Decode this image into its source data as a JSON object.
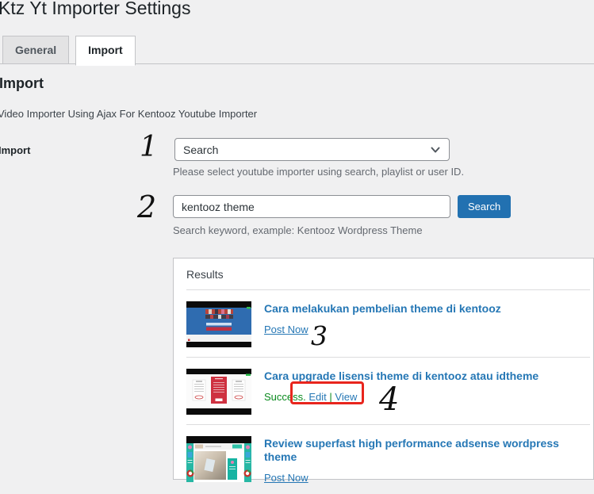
{
  "page": {
    "title": "Ktz Yt Importer Settings"
  },
  "tabs": [
    {
      "label": "General",
      "active": false
    },
    {
      "label": "Import",
      "active": true
    }
  ],
  "section": {
    "heading": "Import",
    "description": "Video Importer Using Ajax For Kentooz Youtube Importer"
  },
  "form": {
    "import_label": "Import",
    "importer_select": {
      "selected_value": "Search",
      "help": "Please select youtube importer using search, playlist or user ID."
    },
    "keyword_input": {
      "value": "kentooz theme",
      "help": "Search keyword, example: Kentooz Wordpress Theme"
    },
    "search_button_label": "Search"
  },
  "results": {
    "heading": "Results",
    "items": [
      {
        "title": "Cara melakukan pembelian theme di kentooz",
        "action": "Post Now",
        "thumb": "blue-storefront-video-thumbnail"
      },
      {
        "title": "Cara upgrade lisensi theme di kentooz atau idtheme",
        "status": "Success.",
        "edit_link": "Edit",
        "separator": "|",
        "view_link": "View",
        "thumb": "pricing-table-video-thumbnail"
      },
      {
        "title": "Review superfast high performance adsense wordpress theme",
        "action": "Post Now",
        "thumb": "teal-website-video-thumbnail"
      }
    ]
  },
  "annotations": {
    "steps": [
      "1",
      "2",
      "3",
      "4"
    ],
    "highlight_box_color": "#e8251d"
  },
  "colors": {
    "accent_blue": "#2271b1",
    "link_blue": "#2577b5",
    "success_green": "#0a8a1e",
    "panel_border": "#c3c4c7",
    "page_background": "#f0f0f1"
  }
}
